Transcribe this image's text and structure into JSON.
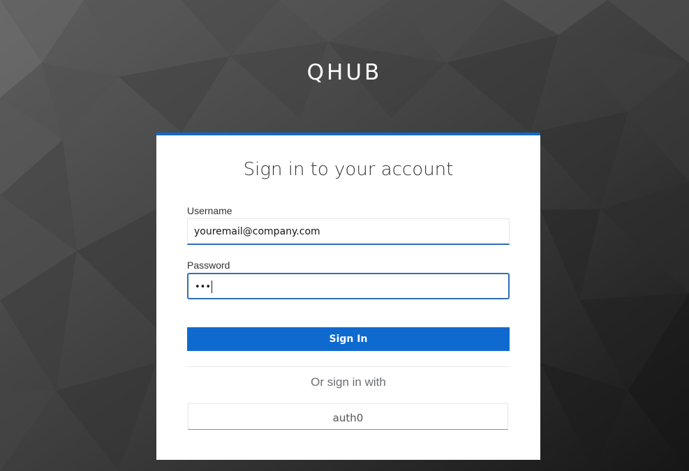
{
  "brand": {
    "name": "QHUB"
  },
  "login": {
    "title": "Sign in to your account",
    "username": {
      "label": "Username",
      "value": "youremail@company.com"
    },
    "password": {
      "label": "Password",
      "masked_value": "•••"
    },
    "sign_in_label": "Sign In",
    "alt_label": "Or sign in with",
    "providers": [
      {
        "label": "auth0"
      }
    ]
  },
  "colors": {
    "accent": "#0f6acf",
    "background": "#3a3a3a",
    "card": "#ffffff"
  }
}
